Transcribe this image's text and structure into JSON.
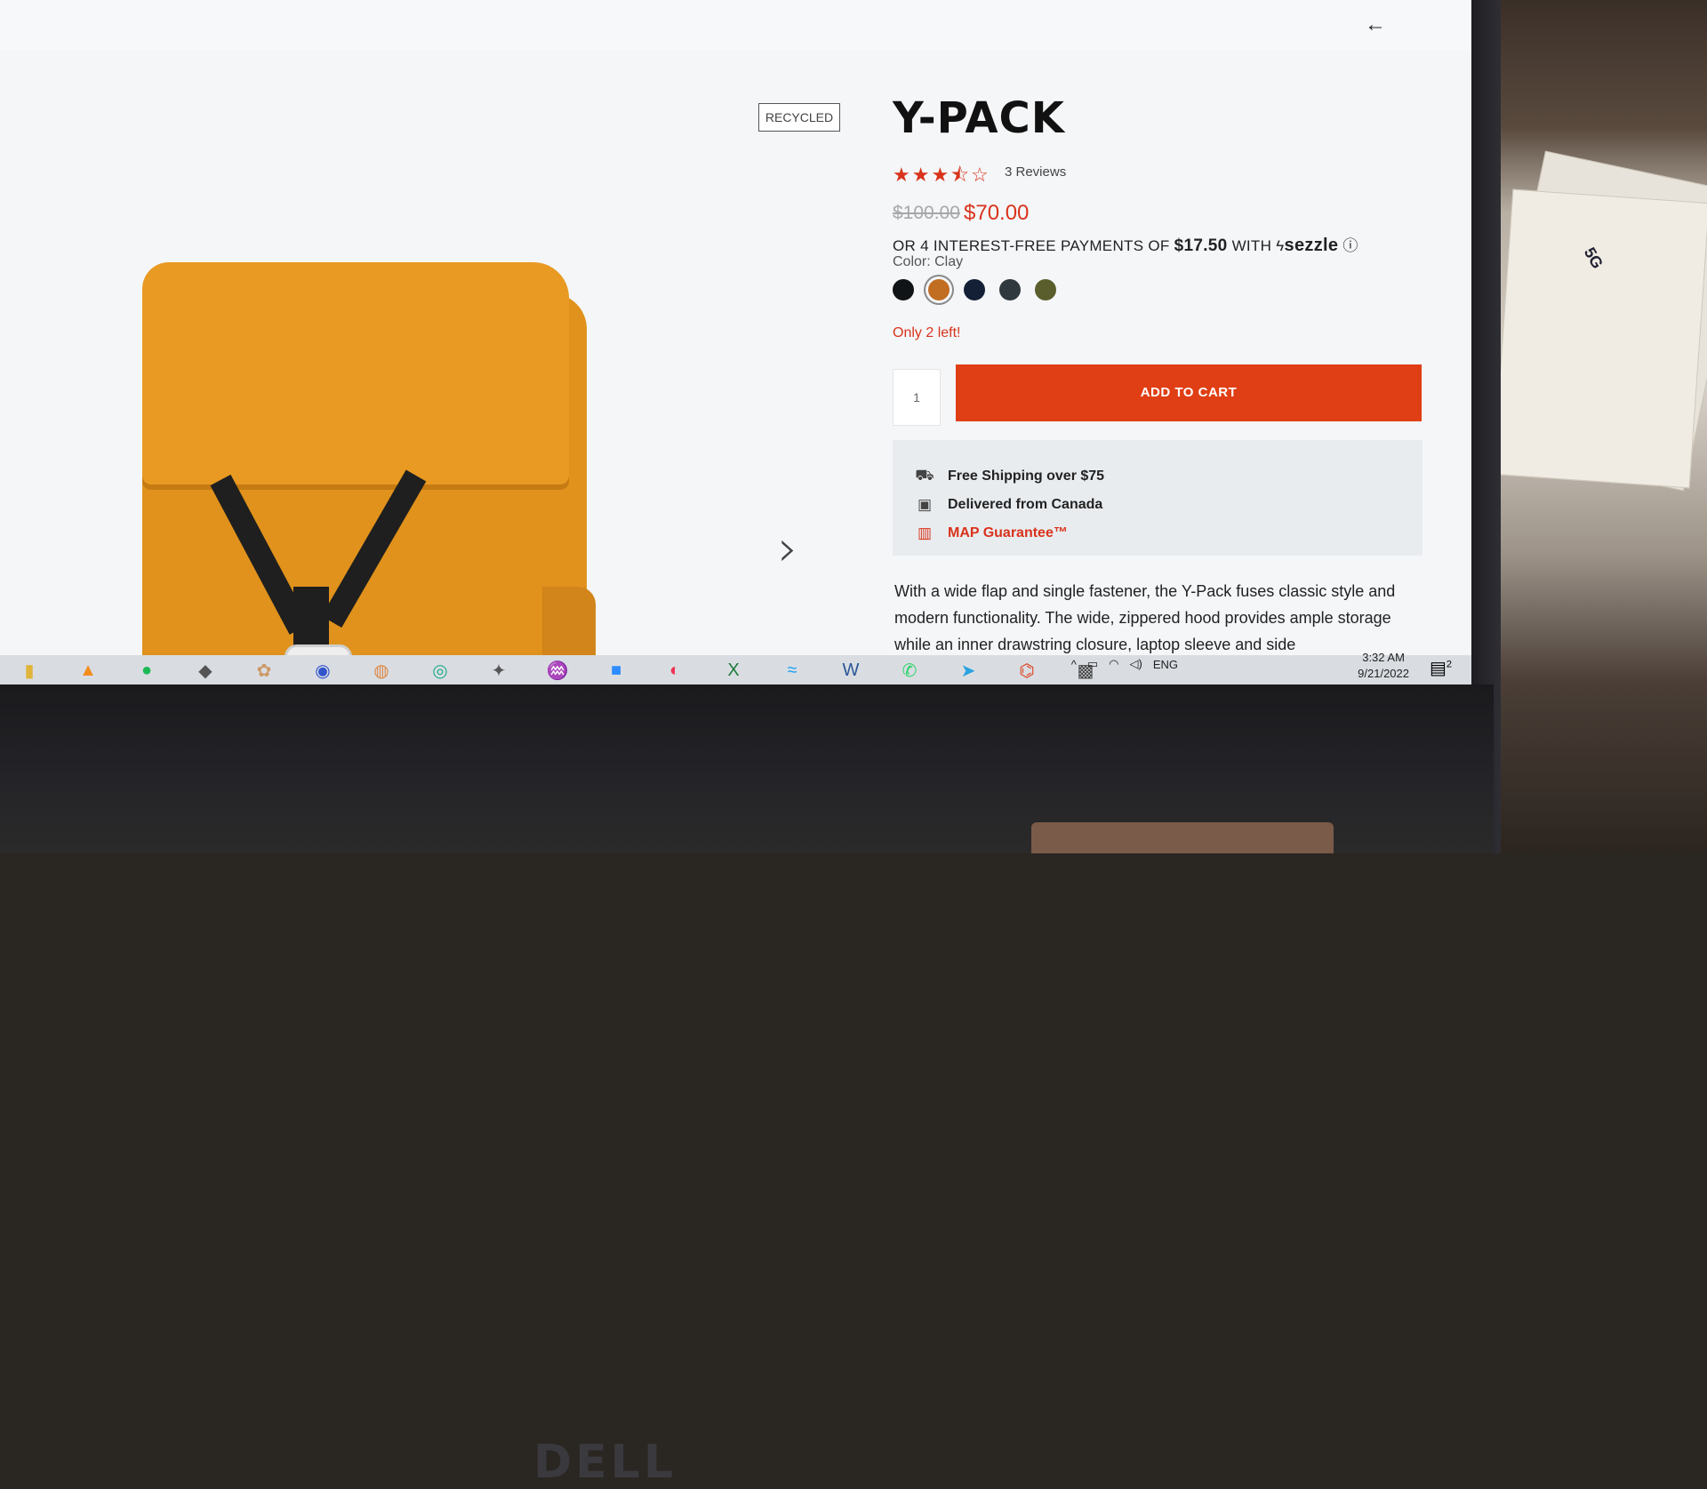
{
  "product": {
    "badge": "RECYCLED",
    "title": "Y-PACK",
    "rating_stars": "★★★⯪☆",
    "rating_value": 3.5,
    "reviews": "3 Reviews",
    "price_old": "$100.00",
    "price_new": "$70.00",
    "sezzle_prefix": "OR 4 INTEREST-FREE PAYMENTS OF",
    "sezzle_amount": "$17.50",
    "sezzle_with": "WITH",
    "sezzle_brand": "sezzle",
    "color_label": "Color: Clay",
    "swatches": [
      "#111417",
      "#c16d22",
      "#142035",
      "#30393e",
      "#5a5e2c"
    ],
    "selected_swatch": 1,
    "stock": "Only 2 left!",
    "quantity": "1",
    "add_to_cart": "ADD TO CART"
  },
  "perks": {
    "shipping": "Free Shipping over $75",
    "delivered": "Delivered from Canada",
    "map": "MAP Guarantee™"
  },
  "description": "With a wide flap and single fastener, the Y-Pack fuses classic style and modern functionality. The wide, zippered hood provides ample storage while an inner drawstring closure, laptop sleeve and side",
  "taskbar": {
    "lang": "ENG",
    "time": "3:32 AM",
    "date": "9/21/2022",
    "notifications": "2"
  },
  "bezel": {
    "brand": "DELL"
  },
  "photo": {
    "paper_text": "5G"
  },
  "colors": {
    "accent": "#e03e14",
    "price": "#d9331b"
  }
}
